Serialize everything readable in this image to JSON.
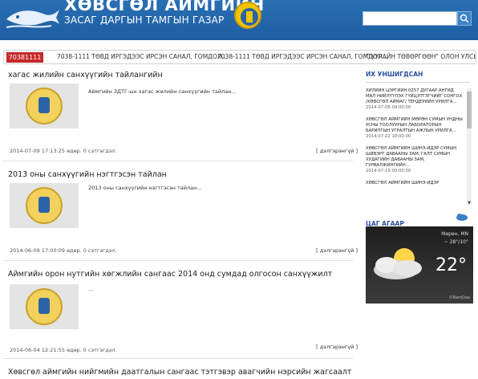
{
  "header": {
    "title": "ХӨВСГӨЛ АЙМГИЙН",
    "subtitle": "ЗАСАГ ДАРГЫН ТАМГЫН ГАЗАР",
    "search_placeholder": ""
  },
  "ticker": {
    "badge": "70381111",
    "items": [
      "7038-1111 ТӨВД ИРГЭДЭЭС ИРСЭН САНАЛ, ГОМДОЛ...",
      "7038-1111 ТӨВД ИРГЭДЭЭС ИРСЭН САНАЛ, ГОМДОЛ...",
      "\"ТУУРАЙН ТӨВӨРГӨӨН\" ОЛОН УЛСЫ"
    ]
  },
  "articles": [
    {
      "title": "хагас жилийн санхүүгийн тайлангийн",
      "snippet": "Аймгийн ЗДТГ-ын хагас жилийн санхүүгийн тайлан...",
      "meta": "2014-07-09 17:13:25 өдөр. 0 сэтгэгдэл.",
      "more": "[ дэлгэрэнгүй ]"
    },
    {
      "title": "2013 оны санхүүгийн нэгтгэсэн тайлан",
      "snippet": "2013 оны санхүүгийн нэгтгэсэн тайлан...",
      "meta": "2014-06-09 17:00:09 өдөр. 0 сэтгэгдэл.",
      "more": "[ дэлгэрэнгүй ]"
    },
    {
      "title": "Аймгийн орон нутгийн хөгжлийн сангаас 2014 онд сумдад олгосон санхүүжилт",
      "snippet": "...",
      "meta": "2014-06-04 12:21:55 өдөр. 0 сэтгэгдэл.",
      "more": "[ дэлгэрэнгүй ]"
    },
    {
      "title": "Хөвсгөл аймгийн нийгмийн даатгалын сангаас тэтгэвэр авагчийн нэрсийн жагсаалт"
    }
  ],
  "sidebar": {
    "popular_heading": "ИХ УНШИГДСАН",
    "popular": [
      {
        "title": "ХИЛИЙН ЦЭРГИЙН 0257 ДУГААР АНГИД МАЛ НИЙЛҮҮЛЭХ ГҮЙЦЭТГЭГЧИЙГ СОНГОХ /ХӨВСГӨЛ АЙМАГ/ ТЕНДЕРИЙН УРИЛГА...",
        "date": "2014-07-08 09:00:00"
      },
      {
        "title": "ХӨВСГӨЛ АЙМГИЙН МӨРӨН СУМЫН УНДНЫ УСНЫ ТООЛУУРЫН ЛАБОРАТОРЫН БАРИЛГЫН УГРАЛТЫН АЖЛЫН УРИЛГА...",
        "date": "2014-07-22 18:00:00"
      },
      {
        "title": "ХӨВСГӨЛ АЙМГИЙН ШИНЭ-ИДЭР СУМЫН ШИВЭРТ ДАВААНЫ ЗАМ, ГАЛТ СУМЫН ХУДАГИЙН ДАВААНЫ ЗАМ, ГУРВАЛЖИНГИЙН...",
        "date": "2014-07-19 09:00:00"
      },
      {
        "title": "ХӨВСГӨЛ АЙМГИЙН ШИНЭ-ИДЭР",
        "date": ""
      }
    ],
    "weather_heading": "ЦАГ АГААР",
    "weather": {
      "city": "Мөрөн, MN",
      "range": "~ 28°/10°",
      "temp": "22°",
      "credit": "©BamDaa"
    }
  },
  "colors": {
    "header_blue": "#1d5ea3",
    "badge_red": "#c62828",
    "link_blue": "#2a4fa0"
  }
}
